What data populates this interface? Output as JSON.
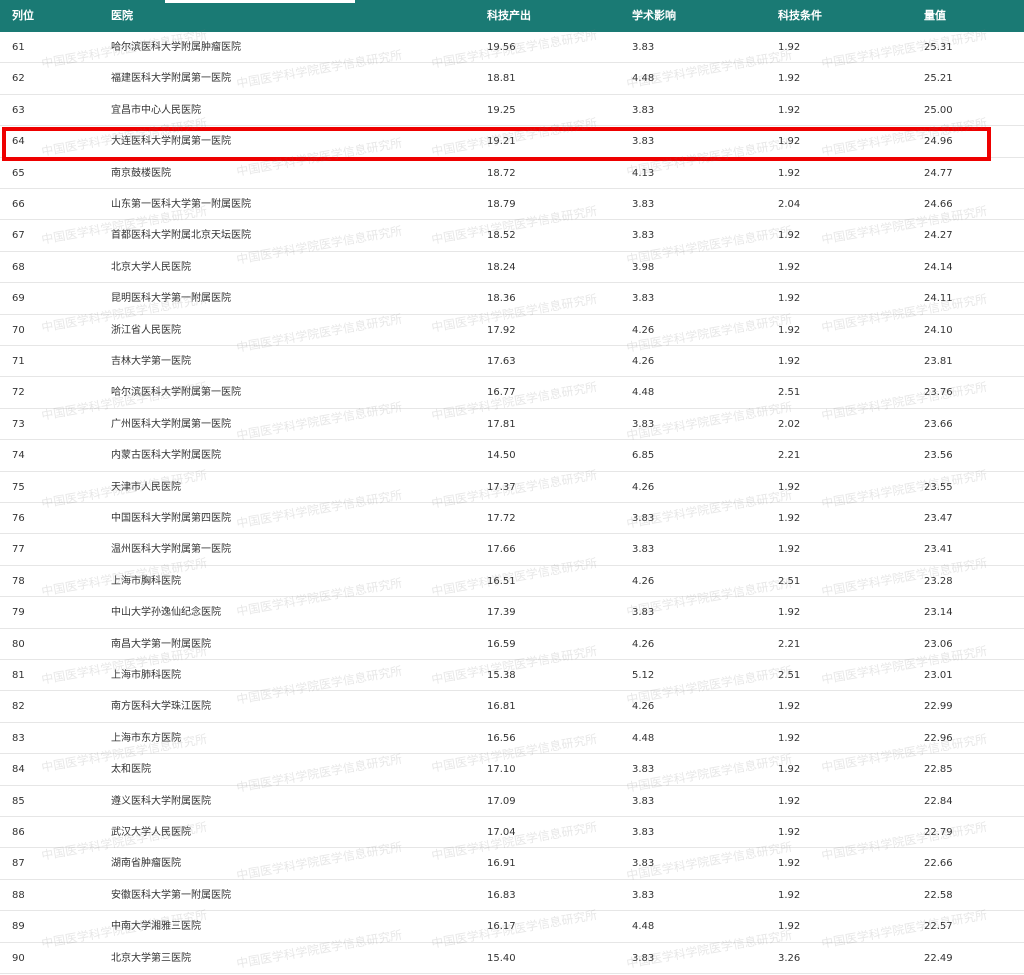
{
  "table": {
    "headers": {
      "rank": "列位",
      "hospital": "医院",
      "tech_output": "科技产出",
      "academic_impact": "学术影响",
      "tech_conditions": "科技条件",
      "score": "量值"
    },
    "highlighted_rank": "64",
    "rows": [
      {
        "rank": "61",
        "hospital": "哈尔滨医科大学附属肿瘤医院",
        "tech_output": "19.56",
        "academic_impact": "3.83",
        "tech_conditions": "1.92",
        "score": "25.31"
      },
      {
        "rank": "62",
        "hospital": "福建医科大学附属第一医院",
        "tech_output": "18.81",
        "academic_impact": "4.48",
        "tech_conditions": "1.92",
        "score": "25.21"
      },
      {
        "rank": "63",
        "hospital": "宜昌市中心人民医院",
        "tech_output": "19.25",
        "academic_impact": "3.83",
        "tech_conditions": "1.92",
        "score": "25.00"
      },
      {
        "rank": "64",
        "hospital": "大连医科大学附属第一医院",
        "tech_output": "19.21",
        "academic_impact": "3.83",
        "tech_conditions": "1.92",
        "score": "24.96"
      },
      {
        "rank": "65",
        "hospital": "南京鼓楼医院",
        "tech_output": "18.72",
        "academic_impact": "4.13",
        "tech_conditions": "1.92",
        "score": "24.77"
      },
      {
        "rank": "66",
        "hospital": "山东第一医科大学第一附属医院",
        "tech_output": "18.79",
        "academic_impact": "3.83",
        "tech_conditions": "2.04",
        "score": "24.66"
      },
      {
        "rank": "67",
        "hospital": "首都医科大学附属北京天坛医院",
        "tech_output": "18.52",
        "academic_impact": "3.83",
        "tech_conditions": "1.92",
        "score": "24.27"
      },
      {
        "rank": "68",
        "hospital": "北京大学人民医院",
        "tech_output": "18.24",
        "academic_impact": "3.98",
        "tech_conditions": "1.92",
        "score": "24.14"
      },
      {
        "rank": "69",
        "hospital": "昆明医科大学第一附属医院",
        "tech_output": "18.36",
        "academic_impact": "3.83",
        "tech_conditions": "1.92",
        "score": "24.11"
      },
      {
        "rank": "70",
        "hospital": "浙江省人民医院",
        "tech_output": "17.92",
        "academic_impact": "4.26",
        "tech_conditions": "1.92",
        "score": "24.10"
      },
      {
        "rank": "71",
        "hospital": "吉林大学第一医院",
        "tech_output": "17.63",
        "academic_impact": "4.26",
        "tech_conditions": "1.92",
        "score": "23.81"
      },
      {
        "rank": "72",
        "hospital": "哈尔滨医科大学附属第一医院",
        "tech_output": "16.77",
        "academic_impact": "4.48",
        "tech_conditions": "2.51",
        "score": "23.76"
      },
      {
        "rank": "73",
        "hospital": "广州医科大学附属第一医院",
        "tech_output": "17.81",
        "academic_impact": "3.83",
        "tech_conditions": "2.02",
        "score": "23.66"
      },
      {
        "rank": "74",
        "hospital": "内蒙古医科大学附属医院",
        "tech_output": "14.50",
        "academic_impact": "6.85",
        "tech_conditions": "2.21",
        "score": "23.56"
      },
      {
        "rank": "75",
        "hospital": "天津市人民医院",
        "tech_output": "17.37",
        "academic_impact": "4.26",
        "tech_conditions": "1.92",
        "score": "23.55"
      },
      {
        "rank": "76",
        "hospital": "中国医科大学附属第四医院",
        "tech_output": "17.72",
        "academic_impact": "3.83",
        "tech_conditions": "1.92",
        "score": "23.47"
      },
      {
        "rank": "77",
        "hospital": "温州医科大学附属第一医院",
        "tech_output": "17.66",
        "academic_impact": "3.83",
        "tech_conditions": "1.92",
        "score": "23.41"
      },
      {
        "rank": "78",
        "hospital": "上海市胸科医院",
        "tech_output": "16.51",
        "academic_impact": "4.26",
        "tech_conditions": "2.51",
        "score": "23.28"
      },
      {
        "rank": "79",
        "hospital": "中山大学孙逸仙纪念医院",
        "tech_output": "17.39",
        "academic_impact": "3.83",
        "tech_conditions": "1.92",
        "score": "23.14"
      },
      {
        "rank": "80",
        "hospital": "南昌大学第一附属医院",
        "tech_output": "16.59",
        "academic_impact": "4.26",
        "tech_conditions": "2.21",
        "score": "23.06"
      },
      {
        "rank": "81",
        "hospital": "上海市肺科医院",
        "tech_output": "15.38",
        "academic_impact": "5.12",
        "tech_conditions": "2.51",
        "score": "23.01"
      },
      {
        "rank": "82",
        "hospital": "南方医科大学珠江医院",
        "tech_output": "16.81",
        "academic_impact": "4.26",
        "tech_conditions": "1.92",
        "score": "22.99"
      },
      {
        "rank": "83",
        "hospital": "上海市东方医院",
        "tech_output": "16.56",
        "academic_impact": "4.48",
        "tech_conditions": "1.92",
        "score": "22.96"
      },
      {
        "rank": "84",
        "hospital": "太和医院",
        "tech_output": "17.10",
        "academic_impact": "3.83",
        "tech_conditions": "1.92",
        "score": "22.85"
      },
      {
        "rank": "85",
        "hospital": "遵义医科大学附属医院",
        "tech_output": "17.09",
        "academic_impact": "3.83",
        "tech_conditions": "1.92",
        "score": "22.84"
      },
      {
        "rank": "86",
        "hospital": "武汉大学人民医院",
        "tech_output": "17.04",
        "academic_impact": "3.83",
        "tech_conditions": "1.92",
        "score": "22.79"
      },
      {
        "rank": "87",
        "hospital": "湖南省肿瘤医院",
        "tech_output": "16.91",
        "academic_impact": "3.83",
        "tech_conditions": "1.92",
        "score": "22.66"
      },
      {
        "rank": "88",
        "hospital": "安徽医科大学第一附属医院",
        "tech_output": "16.83",
        "academic_impact": "3.83",
        "tech_conditions": "1.92",
        "score": "22.58"
      },
      {
        "rank": "89",
        "hospital": "中南大学湘雅三医院",
        "tech_output": "16.17",
        "academic_impact": "4.48",
        "tech_conditions": "1.92",
        "score": "22.57"
      },
      {
        "rank": "90",
        "hospital": "北京大学第三医院",
        "tech_output": "15.40",
        "academic_impact": "3.83",
        "tech_conditions": "3.26",
        "score": "22.49"
      }
    ]
  },
  "watermark_text": "中国医学科学院医学信息研究所",
  "colors": {
    "header_bg": "#1a7a74",
    "highlight_border": "#ee0000"
  }
}
